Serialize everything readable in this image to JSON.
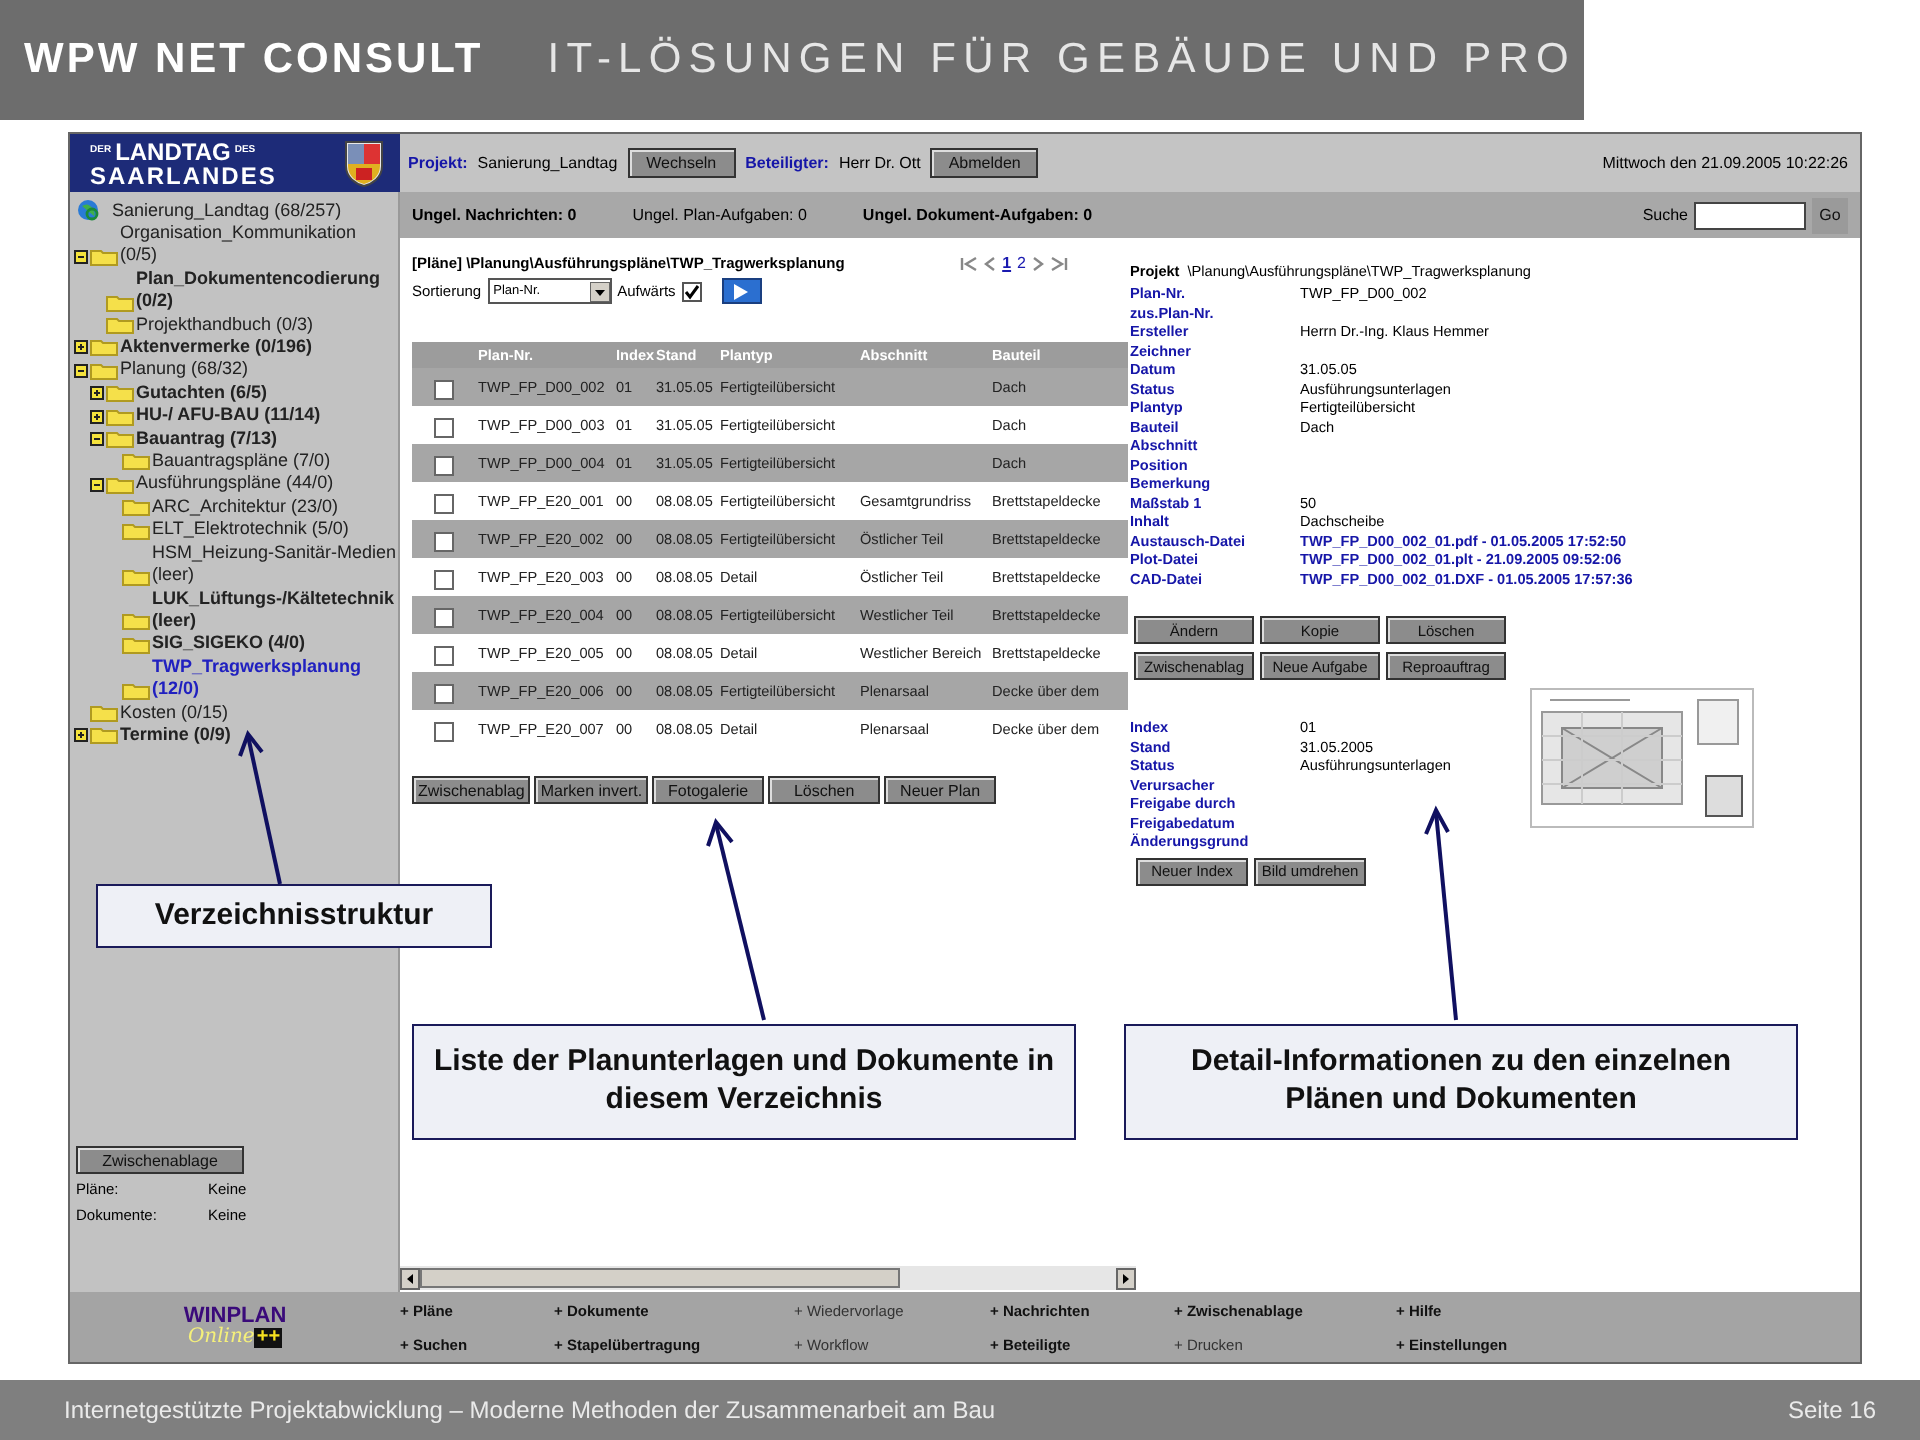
{
  "slide_header": {
    "title": "WPW NET CONSULT",
    "tagline": "IT-LÖSUNGEN FÜR GEBÄUDE UND PRO"
  },
  "app": {
    "logo": {
      "top": "DER",
      "name": "LANDTAG",
      "suffix": "DES",
      "region": "SAARLANDES"
    },
    "project_bar": {
      "project_label": "Projekt:",
      "project": "Sanierung_Landtag",
      "change_button": "Wechseln",
      "participant_label": "Beteiligter:",
      "participant": "Herr Dr. Ott",
      "logout_button": "Abmelden",
      "datetime": "Mittwoch den 21.09.2005 10:22:26"
    },
    "status_bar": {
      "counters": [
        {
          "text": "Ungel. Nachrichten: 0",
          "emphasized": true
        },
        {
          "text": "Ungel. Plan-Aufgaben: 0",
          "emphasized": false
        },
        {
          "text": "Ungel. Dokument-Aufgaben: 0",
          "emphasized": true
        }
      ],
      "search_label": "Suche",
      "search_button": "Go"
    },
    "sidebar": {
      "tree": [
        {
          "label": "Sanierung_Landtag (68/257)",
          "kind": "root",
          "emphasized": false,
          "selected": false,
          "children": [
            {
              "label": "Organisation_Kommunikation (0/5)",
              "kind": "folder",
              "expanded": true,
              "emphasized": false,
              "selected": false,
              "children": [
                {
                  "label": "Plan_Dokumentencodierung (0/2)",
                  "kind": "folder",
                  "emphasized": true,
                  "selected": false
                },
                {
                  "label": "Projekthandbuch (0/3)",
                  "kind": "folder",
                  "emphasized": false,
                  "selected": false
                }
              ]
            },
            {
              "label": "Aktenvermerke (0/196)",
              "kind": "folder",
              "expanded": false,
              "emphasized": true,
              "selected": false
            },
            {
              "label": "Planung (68/32)",
              "kind": "folder",
              "expanded": true,
              "emphasized": false,
              "selected": false,
              "children": [
                {
                  "label": "Gutachten (6/5)",
                  "kind": "folder",
                  "expanded": false,
                  "emphasized": true,
                  "selected": false
                },
                {
                  "label": "HU-/ AFU-BAU (11/14)",
                  "kind": "folder",
                  "expanded": false,
                  "emphasized": true,
                  "selected": false
                },
                {
                  "label": "Bauantrag (7/13)",
                  "kind": "folder",
                  "expanded": true,
                  "emphasized": true,
                  "selected": false,
                  "children": [
                    {
                      "label": "Bauantragspläne (7/0)",
                      "kind": "folder",
                      "emphasized": false,
                      "selected": false
                    }
                  ]
                },
                {
                  "label": "Ausführungspläne (44/0)",
                  "kind": "folder",
                  "expanded": true,
                  "emphasized": false,
                  "selected": false,
                  "children": [
                    {
                      "label": "ARC_Architektur (23/0)",
                      "kind": "folder",
                      "emphasized": false,
                      "selected": false
                    },
                    {
                      "label": "ELT_Elektrotechnik (5/0)",
                      "kind": "folder",
                      "emphasized": false,
                      "selected": false
                    },
                    {
                      "label": "HSM_Heizung-Sanitär-Medien (leer)",
                      "kind": "folder",
                      "emphasized": false,
                      "selected": false
                    },
                    {
                      "label": "LUK_Lüftungs-/Kältetechnik (leer)",
                      "kind": "folder",
                      "emphasized": true,
                      "selected": false
                    },
                    {
                      "label": "SIG_SIGEKO (4/0)",
                      "kind": "folder",
                      "emphasized": true,
                      "selected": false
                    },
                    {
                      "label": "TWP_Tragwerksplanung (12/0)",
                      "kind": "folder",
                      "emphasized": true,
                      "selected": true
                    }
                  ]
                }
              ]
            },
            {
              "label": "Kosten (0/15)",
              "kind": "folder",
              "emphasized": false,
              "selected": false
            },
            {
              "label": "Termine (0/9)",
              "kind": "folder",
              "expanded": false,
              "emphasized": true,
              "selected": false
            }
          ]
        }
      ],
      "clipboard": {
        "button": "Zwischenablage",
        "rows": [
          {
            "label": "Pläne:",
            "value": "Keine"
          },
          {
            "label": "Dokumente:",
            "value": "Keine"
          }
        ]
      }
    },
    "plan_list": {
      "breadcrumb": "[Pläne] \\Planung\\Ausführungspläne\\TWP_Tragwerksplanung",
      "pages": [
        {
          "label": "1",
          "selected": true
        },
        {
          "label": "2",
          "selected": false
        }
      ],
      "sort_label": "Sortierung",
      "sort_value": "Plan-Nr.",
      "ascending_label": "Aufwärts",
      "ascending": true,
      "columns": [
        "Plan-Nr.",
        "Index",
        "Stand",
        "Plantyp",
        "Abschnitt",
        "Bauteil"
      ],
      "rows": [
        {
          "checked": false,
          "cells": [
            "TWP_FP_D00_002",
            "01",
            "31.05.05",
            "Fertigteilübersicht",
            null,
            "Dach"
          ]
        },
        {
          "checked": false,
          "cells": [
            "TWP_FP_D00_003",
            "01",
            "31.05.05",
            "Fertigteilübersicht",
            null,
            "Dach"
          ]
        },
        {
          "checked": false,
          "cells": [
            "TWP_FP_D00_004",
            "01",
            "31.05.05",
            "Fertigteilübersicht",
            null,
            "Dach"
          ]
        },
        {
          "checked": false,
          "cells": [
            "TWP_FP_E20_001",
            "00",
            "08.08.05",
            "Fertigteilübersicht",
            "Gesamtgrundriss",
            "Brettstapeldecke"
          ]
        },
        {
          "checked": false,
          "cells": [
            "TWP_FP_E20_002",
            "00",
            "08.08.05",
            "Fertigteilübersicht",
            "Östlicher Teil",
            "Brettstapeldecke"
          ]
        },
        {
          "checked": false,
          "cells": [
            "TWP_FP_E20_003",
            "00",
            "08.08.05",
            "Detail",
            "Östlicher Teil",
            "Brettstapeldecke"
          ]
        },
        {
          "checked": false,
          "cells": [
            "TWP_FP_E20_004",
            "00",
            "08.08.05",
            "Fertigteilübersicht",
            "Westlicher Teil",
            "Brettstapeldecke"
          ]
        },
        {
          "checked": false,
          "cells": [
            "TWP_FP_E20_005",
            "00",
            "08.08.05",
            "Detail",
            "Westlicher Bereich",
            "Brettstapeldecke"
          ]
        },
        {
          "checked": false,
          "cells": [
            "TWP_FP_E20_006",
            "00",
            "08.08.05",
            "Fertigteilübersicht",
            "Plenarsaal",
            "Decke über dem"
          ]
        },
        {
          "checked": false,
          "cells": [
            "TWP_FP_E20_007",
            "00",
            "08.08.05",
            "Detail",
            "Plenarsaal",
            "Decke über dem"
          ]
        }
      ],
      "buttons": [
        "Zwischenablag",
        "Marken invert.",
        "Fotogalerie",
        "Löschen",
        "Neuer Plan"
      ]
    },
    "detail": {
      "project_label": "Projekt",
      "project_path": "\\Planung\\Ausführungspläne\\TWP_Tragwerksplanung",
      "fields": [
        {
          "label": "Plan-Nr.",
          "value": "TWP_FP_D00_002",
          "kind": "text"
        },
        {
          "label": "zus.Plan-Nr.",
          "kind": "text"
        },
        {
          "label": "Ersteller",
          "value": "Herrn Dr.-Ing. Klaus Hemmer",
          "kind": "text"
        },
        {
          "label": "Zeichner",
          "kind": "text"
        },
        {
          "label": "Datum",
          "value": "31.05.05",
          "kind": "text"
        },
        {
          "label": "Status",
          "value": "Ausführungsunterlagen",
          "kind": "text"
        },
        {
          "label": "Plantyp",
          "value": "Fertigteilübersicht",
          "kind": "text"
        },
        {
          "label": "Bauteil",
          "value": "Dach",
          "kind": "text"
        },
        {
          "label": "Abschnitt",
          "kind": "text"
        },
        {
          "label": "Position",
          "kind": "text"
        },
        {
          "label": "Bemerkung",
          "kind": "text"
        },
        {
          "label": "Maßstab 1",
          "value": "50",
          "kind": "text"
        },
        {
          "label": "Inhalt",
          "value": "Dachscheibe",
          "kind": "text"
        },
        {
          "label": "Austausch-Datei",
          "value": "TWP_FP_D00_002_01.pdf - 01.05.2005 17:52:50",
          "kind": "link"
        },
        {
          "label": "Plot-Datei",
          "value": "TWP_FP_D00_002_01.plt - 21.09.2005 09:52:06",
          "kind": "link"
        },
        {
          "label": "CAD-Datei",
          "value": "TWP_FP_D00_002_01.DXF - 01.05.2005 17:57:36",
          "kind": "link"
        }
      ],
      "buttons": [
        "Ändern",
        "Kopie",
        "Löschen",
        "Zwischenablag",
        "Neue Aufgabe",
        "Reproauftrag"
      ],
      "index_fields": [
        {
          "label": "Index",
          "value": "01"
        },
        {
          "label": "Stand",
          "value": "31.05.2005"
        },
        {
          "label": "Status",
          "value": "Ausführungsunterlagen"
        },
        {
          "label": "Verursacher"
        },
        {
          "label": "Freigabe durch"
        },
        {
          "label": "Freigabedatum"
        },
        {
          "label": "Änderungsgrund"
        }
      ],
      "index_buttons": [
        "Neuer Index",
        "Bild umdrehen"
      ]
    },
    "navigation": [
      {
        "label": "+ Pläne",
        "disabled": false
      },
      {
        "label": "+ Dokumente",
        "disabled": false
      },
      {
        "label": "+ Wiedervorlage",
        "disabled": true
      },
      {
        "label": "+ Nachrichten",
        "disabled": false
      },
      {
        "label": "+ Zwischenablage",
        "disabled": false
      },
      {
        "label": "+ Hilfe",
        "disabled": false
      },
      {
        "label": "+ Suchen",
        "disabled": false
      },
      {
        "label": "+ Stapelübertragung",
        "disabled": false
      },
      {
        "label": "+ Workflow",
        "disabled": true
      },
      {
        "label": "+ Beteiligte",
        "disabled": false
      },
      {
        "label": "+ Drucken",
        "disabled": true
      },
      {
        "label": "+ Einstellungen",
        "disabled": false
      }
    ],
    "brand": {
      "name": "WINPLAN",
      "script": "Online",
      "plus": "++"
    }
  },
  "callouts": [
    {
      "text": "Verzeichnisstruktur"
    },
    {
      "text": "Liste der Planunterlagen und Dokumente in diesem Verzeichnis"
    },
    {
      "text": "Detail-Informationen zu den einzelnen Plänen und Dokumenten"
    }
  ],
  "footer": {
    "text": "Internetgestützte Projektabwicklung – Moderne Methoden der Zusammenarbeit am Bau",
    "page": "Seite 16"
  }
}
